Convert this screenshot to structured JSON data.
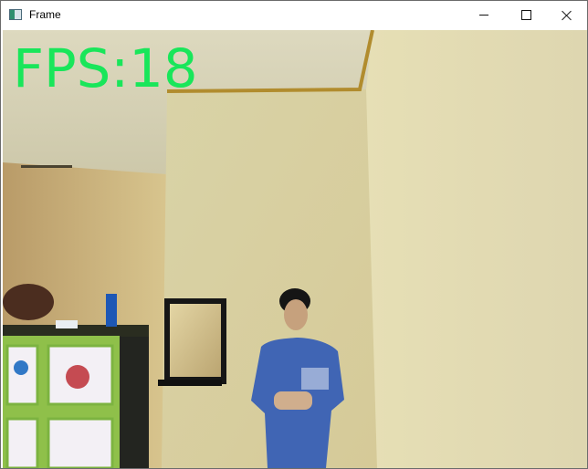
{
  "window": {
    "title": "Frame",
    "icon": "opencv-window-icon",
    "controls": {
      "minimize": "minimize-icon",
      "maximize": "maximize-icon",
      "close": "close-icon"
    }
  },
  "video": {
    "overlay_text": "FPS:18",
    "overlay_color": "#19e65a",
    "scene": "webcam-frame"
  }
}
